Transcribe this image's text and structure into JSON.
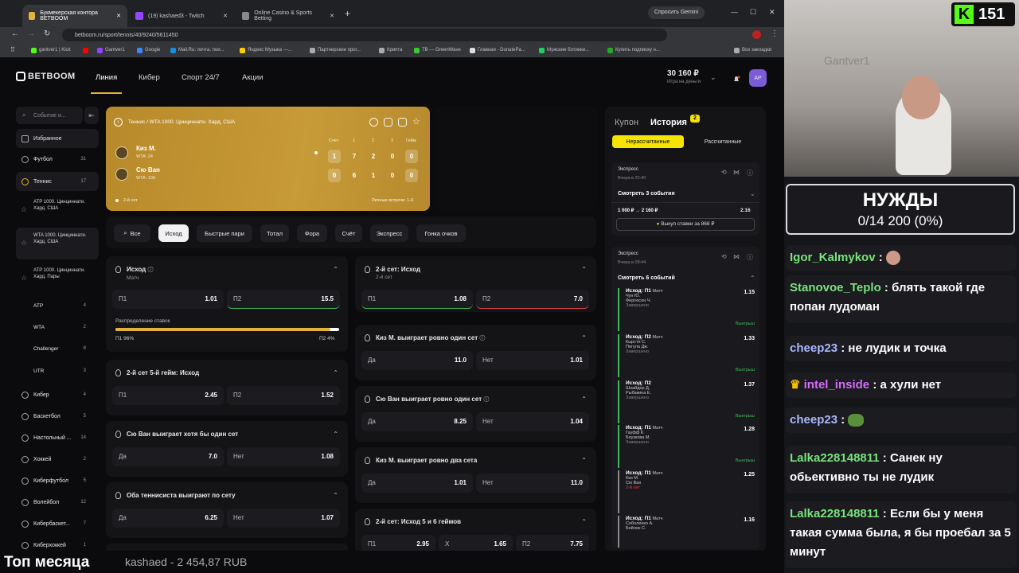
{
  "browser": {
    "tabs": [
      {
        "title": "Букмекерская контора BETBOOM",
        "active": true
      },
      {
        "title": "(19) kashaed3 - Twitch",
        "active": false
      },
      {
        "title": "Online Casino & Sports Betting",
        "active": false
      }
    ],
    "url": "betboom.ru/sport/tennis/40/9240/5611450",
    "gemini": "Спросить Gemini",
    "bookmarks": [
      "gantver1 | Kick",
      "",
      "Gantver1",
      "Google",
      "Mail.Ru: почта, пои...",
      "Яндекс Музыка —...",
      "Партнерские прог...",
      "Крипта",
      "TB — GreenWave",
      "Главная - DonatePa...",
      "Мужские ботинки...",
      "Купить подписку н..."
    ],
    "all_bookmarks": "Все закладки"
  },
  "site": {
    "logo": "BETBOOM",
    "nav": [
      "Линия",
      "Кибер",
      "Спорт 24/7",
      "Акции"
    ],
    "balance": "30 160 ₽",
    "balance_note": "Игра на деньги",
    "avatar": "АР"
  },
  "sidebar": {
    "search_placeholder": "Событие и...",
    "items": [
      {
        "label": "Избранное",
        "count": ""
      },
      {
        "label": "Футбол",
        "count": "31"
      },
      {
        "label": "Теннис",
        "count": "17"
      }
    ],
    "subs": [
      {
        "label": "ATP 1000. Цинциннати. Хард. США"
      },
      {
        "label": "WTA 1000. Цинциннати. Хард. США"
      },
      {
        "label": "ATP 1000. Цинциннати. Хард. Пары"
      }
    ],
    "leagues": [
      {
        "label": "ATP",
        "count": "4"
      },
      {
        "label": "WTA",
        "count": "2"
      },
      {
        "label": "Challenger",
        "count": "8"
      },
      {
        "label": "UTR",
        "count": "3"
      }
    ],
    "sports": [
      {
        "label": "Кибер",
        "count": "4"
      },
      {
        "label": "Баскетбол",
        "count": "5"
      },
      {
        "label": "Настольный ...",
        "count": "14"
      },
      {
        "label": "Хоккей",
        "count": "2"
      },
      {
        "label": "Киберфутбол",
        "count": "5"
      },
      {
        "label": "Волейбол",
        "count": "12"
      },
      {
        "label": "Кибербаскет...",
        "count": "7"
      },
      {
        "label": "Киберхоккей",
        "count": "1"
      }
    ]
  },
  "event": {
    "breadcrumb": "Теннис  /  WTA 1000. Цинциннати. Хард, США",
    "score_head": [
      "Счёт",
      "1",
      "2",
      "3",
      "Гейм"
    ],
    "players": [
      {
        "name": "Киз М.",
        "rank": "WTA: 24",
        "scores": [
          "1",
          "7",
          "2",
          "0",
          "0"
        ]
      },
      {
        "name": "Сю Ван",
        "rank": "WTA: 108",
        "scores": [
          "0",
          "6",
          "1",
          "0",
          "0"
        ]
      }
    ],
    "status": "2-й сет",
    "h2h": "Личные встречи: 1-0"
  },
  "filters": [
    "Все",
    "Исход",
    "Быстрые пари",
    "Тотал",
    "Фора",
    "Счёт",
    "Экспресс",
    "Гонка очков"
  ],
  "markets_left": [
    {
      "title": "Исход",
      "sub": "Матч",
      "o": [
        [
          "П1",
          "1.01"
        ],
        [
          "П2",
          "15.5"
        ]
      ],
      "dist": {
        "label": "Распределение ставок",
        "p1": "П1 96%",
        "p2": "П2 4%",
        "p1_share": 0.96
      }
    },
    {
      "title": "2-й сет 5-й гейм: Исход",
      "sub": "",
      "o": [
        [
          "П1",
          "2.45"
        ],
        [
          "П2",
          "1.52"
        ]
      ]
    },
    {
      "title": "Сю Ван выиграет хотя бы один сет",
      "sub": "",
      "o": [
        [
          "Да",
          "7.0"
        ],
        [
          "Нет",
          "1.08"
        ]
      ]
    },
    {
      "title": "Оба теннисиста выиграют по сету",
      "sub": "",
      "o": [
        [
          "Да",
          "6.25"
        ],
        [
          "Нет",
          "1.07"
        ]
      ]
    }
  ],
  "markets_right": [
    {
      "title": "2-й сет: Исход",
      "sub": "2-й сет",
      "o": [
        [
          "П1",
          "1.08"
        ],
        [
          "П2",
          "7.0"
        ]
      ]
    },
    {
      "title": "Киз М. выиграет ровно один сет",
      "sub": "",
      "o": [
        [
          "Да",
          "11.0"
        ],
        [
          "Нет",
          "1.01"
        ]
      ]
    },
    {
      "title": "Сю Ван выиграет ровно один сет",
      "sub": "",
      "o": [
        [
          "Да",
          "8.25"
        ],
        [
          "Нет",
          "1.04"
        ]
      ]
    },
    {
      "title": "Киз М. выиграет ровно два сета",
      "sub": "",
      "o": [
        [
          "Да",
          "1.01"
        ],
        [
          "Нет",
          "11.0"
        ]
      ]
    },
    {
      "title": "2-й сет: Исход 5 и 6 геймов",
      "sub": "",
      "o": [
        [
          "П1",
          "2.95"
        ],
        [
          "X",
          "1.65"
        ],
        [
          "П2",
          "7.75"
        ]
      ]
    }
  ],
  "coupon": {
    "tabs": [
      "Купон",
      "История"
    ],
    "badge": "2",
    "filters": [
      "Нерассчитанные",
      "Рассчитанные"
    ],
    "bet1": {
      "type": "Экспресс",
      "time": "Вчера в 22:40",
      "show": "Смотреть 3 события",
      "amount": "1 000 ₽ → 2 160 ₽",
      "coef": "2.16",
      "cashout": "Выкуп ставки за 868 ₽"
    },
    "bet2": {
      "type": "Экспресс",
      "time": "Вчера в 08:44",
      "show": "Смотреть 6 событий"
    },
    "legs": [
      {
        "m": "Исход: П1",
        "t": "Матч",
        "p": "Чун Ю.",
        "p2": "Фергюсон Ч.",
        "s": "Завершено",
        "k": "1.15",
        "w": "Выигрыш"
      },
      {
        "m": "Исход: П2",
        "t": "Матч",
        "p": "Кырстя С.",
        "p2": "Пегула Дж.",
        "s": "Завершено",
        "k": "1.33",
        "w": "Выигрыш"
      },
      {
        "m": "Исход: П2",
        "t": "Матч",
        "p": "Шнайдер Д.",
        "p2": "Рыбакина Е.",
        "s": "Завершено",
        "k": "1.37",
        "w": "Выигрыш"
      },
      {
        "m": "Исход: П1",
        "t": "Матч",
        "p": "Гауфф К.",
        "p2": "Боузкова М.",
        "s": "Завершено",
        "k": "1.28",
        "w": "Выигрыш"
      },
      {
        "m": "Исход: П1",
        "t": "Матч",
        "p": "Киз М.",
        "p2": "Сю Ван",
        "s": "2-й сет",
        "k": "1.25",
        "w": ""
      },
      {
        "m": "Исход: П1",
        "t": "Матч",
        "p": "Соболенко А.",
        "p2": "Бейлек С.",
        "s": "",
        "k": "1.16",
        "w": ""
      }
    ]
  },
  "stream": {
    "kick_count": "151",
    "watermark": "Gantver1",
    "goal_title": "НУЖДЫ",
    "goal_progress": "0/14 200 (0%)",
    "chat": [
      {
        "u": "Igor_Kalmykov",
        "m": ""
      },
      {
        "u": "Stanovoe_Teplo",
        "m": "блять такой где попан лудоман"
      },
      {
        "u": "cheep23",
        "m": "не лудик и точка"
      },
      {
        "u": "intel_inside",
        "m": "а хули нет"
      },
      {
        "u": "cheep23",
        "m": ""
      },
      {
        "u": "Lalka228148811",
        "m": "Санек ну обьективно ты не лудик"
      },
      {
        "u": "Lalka228148811",
        "m": "Если бы у меня такая сумма была, я бы проебал за 5 минут"
      }
    ],
    "ticker_title": "Топ месяца",
    "ticker_text": "kashaed - 2 454,87 RUB"
  }
}
